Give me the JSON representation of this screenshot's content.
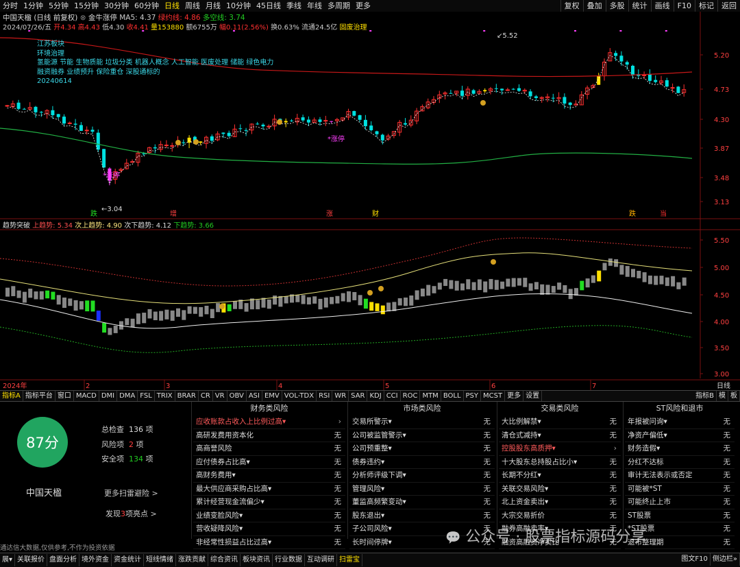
{
  "toolbar": {
    "periods": [
      "分时",
      "1分钟",
      "5分钟",
      "15分钟",
      "30分钟",
      "60分钟",
      "日线",
      "周线",
      "月线",
      "10分钟",
      "45日线",
      "季线",
      "年线",
      "多周期",
      "更多"
    ],
    "active_period": "日线",
    "right_buttons": [
      "复权",
      "叠加",
      "多股",
      "统计",
      "画线",
      "F10",
      "标记",
      "返回"
    ]
  },
  "chart_header": {
    "line1": {
      "name": "中国天楹 (日线 前复权)",
      "indicator": "金牛涨停",
      "ma5": "MA5: 4.37",
      "zhiyin": "绿约线: 4.86",
      "duokong": "多空线: 3.74"
    },
    "line2": {
      "date": "2024/07/26/五",
      "open": "开4.34",
      "high": "高4.43",
      "low": "低4.30",
      "close": "收4.41",
      "vol": "量153880",
      "amount": "额6755万",
      "amp": "幅0.11(2.56%)",
      "turn": "换0.63%",
      "float": "流通24.5亿",
      "concept": "固废治理"
    }
  },
  "concept_notes": [
    "江苏板块",
    "环境治理",
    "氢能源 节能 生物质能 垃圾分类 机器人概念 人工智能 医废处理 储能 绿色电力",
    "融资融券 业绩预升 保险重仓 深股通标的",
    "20240614"
  ],
  "annotations": {
    "high": "5.52",
    "low": "3.04",
    "zt1": "涨停",
    "zt2": "涨停"
  },
  "events": [
    "跌",
    "增",
    "涨",
    "财",
    "跌",
    "当"
  ],
  "price_axis": [
    "5.20",
    "4.73",
    "4.30",
    "3.87",
    "3.48",
    "3.13"
  ],
  "trend_header": {
    "name": "趋势突破",
    "up": "上趋势: 5.34",
    "sub_up": "次上趋势: 4.90",
    "sub_down": "次下趋势: 4.12",
    "down": "下趋势: 3.66"
  },
  "trend_axis": [
    "5.50",
    "5.00",
    "4.50",
    "4.00",
    "3.50",
    "3.00"
  ],
  "date_axis": {
    "year": "2024年",
    "months": [
      "2",
      "3",
      "4",
      "5",
      "6",
      "7"
    ],
    "right": "日线"
  },
  "indicator_bar": [
    "指标A",
    "指标平台",
    "窗口",
    "MACD",
    "DMI",
    "DMA",
    "FSL",
    "TRIX",
    "BRAR",
    "CR",
    "VR",
    "OBV",
    "ASI",
    "EMV",
    "VOL-TDX",
    "RSI",
    "WR",
    "SAR",
    "KDJ",
    "CCI",
    "ROC",
    "MTM",
    "BOLL",
    "PSY",
    "MCST",
    "更多",
    "设置"
  ],
  "indicator_bar_right": [
    "指标B",
    "模",
    "板"
  ],
  "scan": {
    "score": "87分",
    "stock_name": "中国天楹",
    "total_label": "总检查",
    "total": "136",
    "total_unit": "项",
    "risk_label": "风险项",
    "risk": "2",
    "risk_unit": "项",
    "safe_label": "安全项",
    "safe": "134",
    "safe_unit": "项",
    "more": "更多扫雷避险 >",
    "highlight_pre": "发现",
    "highlight_num": "3",
    "highlight_post": "项亮点 >",
    "disclaimer": "通达信大数据,仅供参考,不作为投资依据"
  },
  "risk_columns": [
    {
      "title": "财务类风险",
      "items": [
        {
          "name": "应收账款占收入上比例过高▾",
          "status": "›",
          "warn": true
        },
        {
          "name": "高研发费用资本化",
          "status": "无"
        },
        {
          "name": "高商誉风险",
          "status": "无"
        },
        {
          "name": "应付债券占比高▾",
          "status": "无"
        },
        {
          "name": "高财务费用▾",
          "status": "无"
        },
        {
          "name": "最大供应商采购占比高▾",
          "status": "无"
        },
        {
          "name": "累计经营现金流偏少▾",
          "status": "无"
        },
        {
          "name": "业绩变脸风险▾",
          "status": "无"
        },
        {
          "name": "营收疑降风险▾",
          "status": "无"
        },
        {
          "name": "非经常性损益占比过高▾",
          "status": "无"
        }
      ]
    },
    {
      "title": "市场类风险",
      "items": [
        {
          "name": "交易所警示▾",
          "status": "无"
        },
        {
          "name": "公司被监管警示▾",
          "status": "无"
        },
        {
          "name": "公司预重整▾",
          "status": "无"
        },
        {
          "name": "债券违约▾",
          "status": "无"
        },
        {
          "name": "分析师评级下调▾",
          "status": "无"
        },
        {
          "name": "管理风险▾",
          "status": "无"
        },
        {
          "name": "董监高频繁变动▾",
          "status": "无"
        },
        {
          "name": "股东退出▾",
          "status": "无"
        },
        {
          "name": "子公司风险▾",
          "status": "无"
        },
        {
          "name": "长时间停牌▾",
          "status": "无"
        }
      ]
    },
    {
      "title": "交易类风险",
      "items": [
        {
          "name": "大比例解禁▾",
          "status": "无"
        },
        {
          "name": "清仓式减持▾",
          "status": "无"
        },
        {
          "name": "控股股东高质押▾",
          "status": "›",
          "warn": true
        },
        {
          "name": "十大股东总持股占比小▾",
          "status": "无"
        },
        {
          "name": "长期不分红▾",
          "status": "无"
        },
        {
          "name": "关联交易风险▾",
          "status": "无"
        },
        {
          "name": "北上资金卖出▾",
          "status": "无"
        },
        {
          "name": "大宗交易折价",
          "status": "无"
        },
        {
          "name": "融券高融卖率▾",
          "status": "无"
        },
        {
          "name": "融资高融资净卖比",
          "status": "无"
        }
      ]
    },
    {
      "title": "ST风险和退市",
      "items": [
        {
          "name": "年报被问询▾",
          "status": "无"
        },
        {
          "name": "净资产偏低▾",
          "status": "无"
        },
        {
          "name": "财务造假▾",
          "status": "无"
        },
        {
          "name": "分红不达标",
          "status": "无"
        },
        {
          "name": "审计无法表示或否定",
          "status": "无"
        },
        {
          "name": "可能被*ST",
          "status": "无"
        },
        {
          "name": "可能终止上市",
          "status": "无"
        },
        {
          "name": "ST股票",
          "status": "无"
        },
        {
          "name": "*ST股票",
          "status": "无"
        },
        {
          "name": "退市整理期",
          "status": "无"
        }
      ]
    }
  ],
  "watermark": "公众号 · 股票指标源码分享",
  "bottom_bar": [
    "展▾",
    "关联报价",
    "盘面分析",
    "境外资金",
    "资金统计",
    "短线情绪",
    "涨跌贡献",
    "综合资讯",
    "板块资讯",
    "行业数据",
    "互动调研",
    "扫雷宝"
  ],
  "bottom_bar_active": "扫雷宝",
  "bottom_right": [
    "图文F10",
    "侧边栏»"
  ],
  "colors": {
    "up": "#ff3030",
    "down": "#00e0e0",
    "yellow": "#ffe000",
    "green": "#22cc22",
    "magenta": "#ff40ff"
  }
}
